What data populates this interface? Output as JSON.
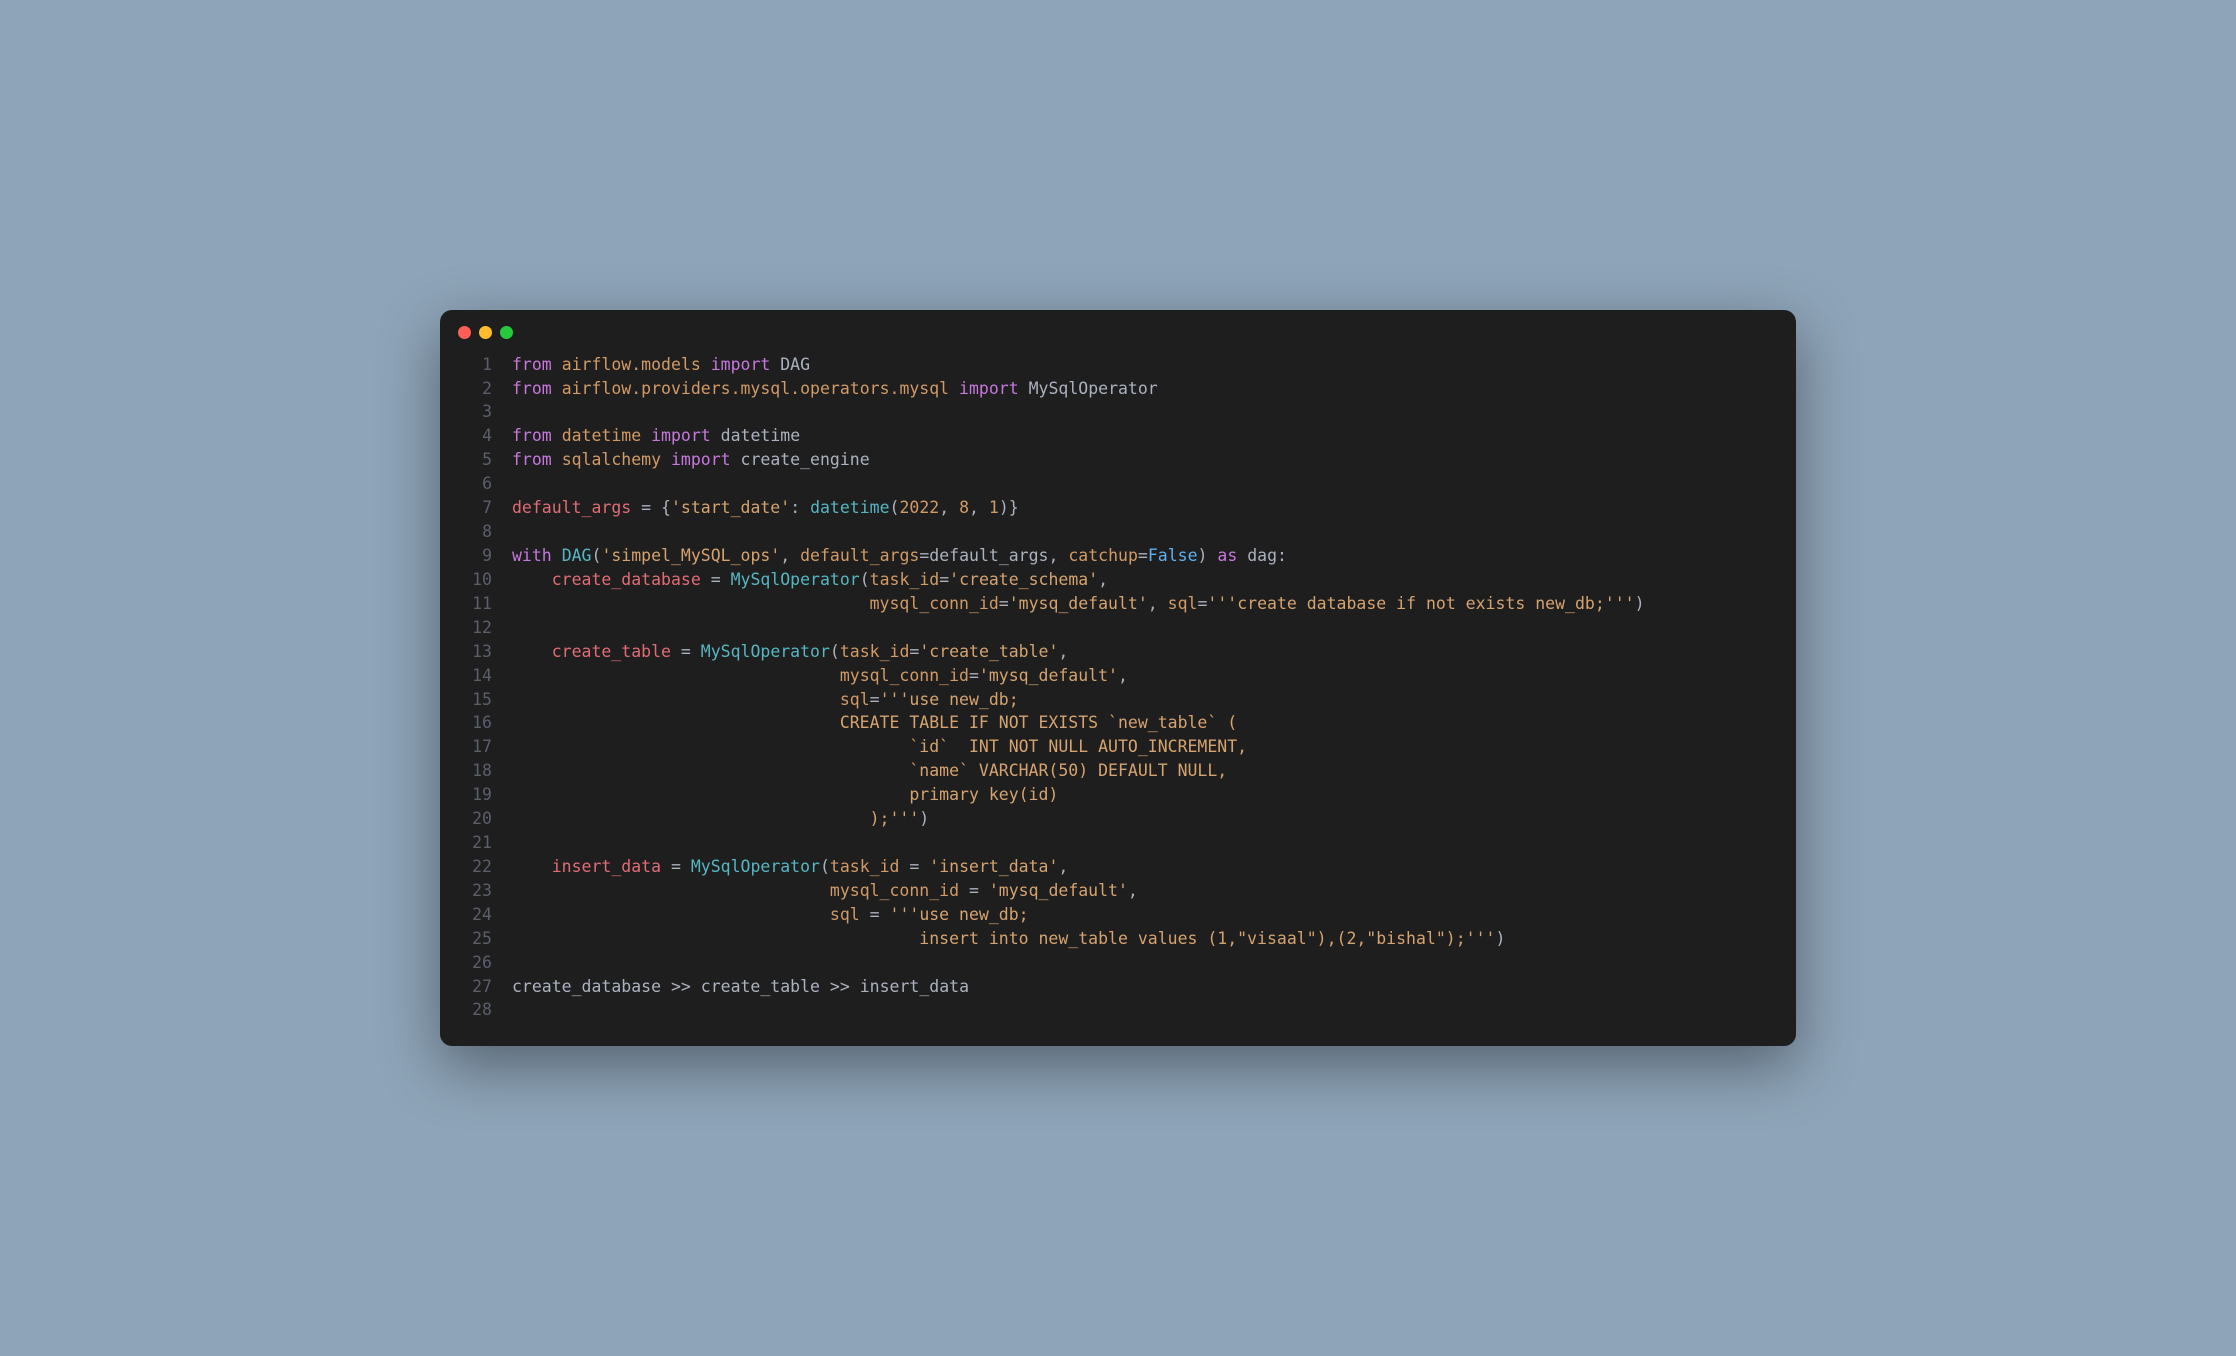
{
  "window": {
    "dots": [
      "red",
      "yellow",
      "green"
    ]
  },
  "code": {
    "lines": [
      {
        "n": 1,
        "tokens": [
          {
            "cls": "tk-keyword",
            "t": "from"
          },
          {
            "cls": "tk-default",
            "t": " "
          },
          {
            "cls": "tk-module",
            "t": "airflow.models"
          },
          {
            "cls": "tk-default",
            "t": " "
          },
          {
            "cls": "tk-keyword",
            "t": "import"
          },
          {
            "cls": "tk-default",
            "t": " "
          },
          {
            "cls": "tk-ident",
            "t": "DAG"
          }
        ]
      },
      {
        "n": 2,
        "tokens": [
          {
            "cls": "tk-keyword",
            "t": "from"
          },
          {
            "cls": "tk-default",
            "t": " "
          },
          {
            "cls": "tk-module",
            "t": "airflow.providers.mysql.operators.mysql"
          },
          {
            "cls": "tk-default",
            "t": " "
          },
          {
            "cls": "tk-keyword",
            "t": "import"
          },
          {
            "cls": "tk-default",
            "t": " "
          },
          {
            "cls": "tk-ident",
            "t": "MySqlOperator"
          }
        ]
      },
      {
        "n": 3,
        "tokens": []
      },
      {
        "n": 4,
        "tokens": [
          {
            "cls": "tk-keyword",
            "t": "from"
          },
          {
            "cls": "tk-default",
            "t": " "
          },
          {
            "cls": "tk-module",
            "t": "datetime"
          },
          {
            "cls": "tk-default",
            "t": " "
          },
          {
            "cls": "tk-keyword",
            "t": "import"
          },
          {
            "cls": "tk-default",
            "t": " "
          },
          {
            "cls": "tk-ident",
            "t": "datetime"
          }
        ]
      },
      {
        "n": 5,
        "tokens": [
          {
            "cls": "tk-keyword",
            "t": "from"
          },
          {
            "cls": "tk-default",
            "t": " "
          },
          {
            "cls": "tk-module",
            "t": "sqlalchemy"
          },
          {
            "cls": "tk-default",
            "t": " "
          },
          {
            "cls": "tk-keyword",
            "t": "import"
          },
          {
            "cls": "tk-default",
            "t": " "
          },
          {
            "cls": "tk-ident",
            "t": "create_engine"
          }
        ]
      },
      {
        "n": 6,
        "tokens": []
      },
      {
        "n": 7,
        "tokens": [
          {
            "cls": "tk-var",
            "t": "default_args"
          },
          {
            "cls": "tk-default",
            "t": " "
          },
          {
            "cls": "tk-op",
            "t": "="
          },
          {
            "cls": "tk-default",
            "t": " "
          },
          {
            "cls": "tk-paren",
            "t": "{"
          },
          {
            "cls": "tk-string",
            "t": "'start_date'"
          },
          {
            "cls": "tk-op",
            "t": ":"
          },
          {
            "cls": "tk-default",
            "t": " "
          },
          {
            "cls": "tk-func",
            "t": "datetime"
          },
          {
            "cls": "tk-paren",
            "t": "("
          },
          {
            "cls": "tk-number",
            "t": "2022"
          },
          {
            "cls": "tk-op",
            "t": ","
          },
          {
            "cls": "tk-default",
            "t": " "
          },
          {
            "cls": "tk-number",
            "t": "8"
          },
          {
            "cls": "tk-op",
            "t": ","
          },
          {
            "cls": "tk-default",
            "t": " "
          },
          {
            "cls": "tk-number",
            "t": "1"
          },
          {
            "cls": "tk-paren",
            "t": ")}"
          }
        ]
      },
      {
        "n": 8,
        "tokens": []
      },
      {
        "n": 9,
        "tokens": [
          {
            "cls": "tk-keyword",
            "t": "with"
          },
          {
            "cls": "tk-default",
            "t": " "
          },
          {
            "cls": "tk-class",
            "t": "DAG"
          },
          {
            "cls": "tk-paren",
            "t": "("
          },
          {
            "cls": "tk-string",
            "t": "'simpel_MySQL_ops'"
          },
          {
            "cls": "tk-op",
            "t": ","
          },
          {
            "cls": "tk-default",
            "t": " "
          },
          {
            "cls": "tk-param",
            "t": "default_args"
          },
          {
            "cls": "tk-op",
            "t": "="
          },
          {
            "cls": "tk-ident",
            "t": "default_args"
          },
          {
            "cls": "tk-op",
            "t": ","
          },
          {
            "cls": "tk-default",
            "t": " "
          },
          {
            "cls": "tk-param",
            "t": "catchup"
          },
          {
            "cls": "tk-op",
            "t": "="
          },
          {
            "cls": "tk-bool",
            "t": "False"
          },
          {
            "cls": "tk-paren",
            "t": ")"
          },
          {
            "cls": "tk-default",
            "t": " "
          },
          {
            "cls": "tk-keyword",
            "t": "as"
          },
          {
            "cls": "tk-default",
            "t": " "
          },
          {
            "cls": "tk-ident",
            "t": "dag"
          },
          {
            "cls": "tk-op",
            "t": ":"
          }
        ]
      },
      {
        "n": 10,
        "tokens": [
          {
            "cls": "tk-default",
            "t": "    "
          },
          {
            "cls": "tk-var",
            "t": "create_database"
          },
          {
            "cls": "tk-default",
            "t": " "
          },
          {
            "cls": "tk-op",
            "t": "="
          },
          {
            "cls": "tk-default",
            "t": " "
          },
          {
            "cls": "tk-class",
            "t": "MySqlOperator"
          },
          {
            "cls": "tk-paren",
            "t": "("
          },
          {
            "cls": "tk-param",
            "t": "task_id"
          },
          {
            "cls": "tk-op",
            "t": "="
          },
          {
            "cls": "tk-string",
            "t": "'create_schema'"
          },
          {
            "cls": "tk-op",
            "t": ","
          }
        ]
      },
      {
        "n": 11,
        "tokens": [
          {
            "cls": "tk-default",
            "t": "                                    "
          },
          {
            "cls": "tk-param",
            "t": "mysql_conn_id"
          },
          {
            "cls": "tk-op",
            "t": "="
          },
          {
            "cls": "tk-string",
            "t": "'mysq_default'"
          },
          {
            "cls": "tk-op",
            "t": ","
          },
          {
            "cls": "tk-default",
            "t": " "
          },
          {
            "cls": "tk-param",
            "t": "sql"
          },
          {
            "cls": "tk-op",
            "t": "="
          },
          {
            "cls": "tk-string",
            "t": "'''create database if not exists new_db;'''"
          },
          {
            "cls": "tk-paren",
            "t": ")"
          }
        ]
      },
      {
        "n": 12,
        "tokens": []
      },
      {
        "n": 13,
        "tokens": [
          {
            "cls": "tk-default",
            "t": "    "
          },
          {
            "cls": "tk-var",
            "t": "create_table"
          },
          {
            "cls": "tk-default",
            "t": " "
          },
          {
            "cls": "tk-op",
            "t": "="
          },
          {
            "cls": "tk-default",
            "t": " "
          },
          {
            "cls": "tk-class",
            "t": "MySqlOperator"
          },
          {
            "cls": "tk-paren",
            "t": "("
          },
          {
            "cls": "tk-param",
            "t": "task_id"
          },
          {
            "cls": "tk-op",
            "t": "="
          },
          {
            "cls": "tk-string",
            "t": "'create_table'"
          },
          {
            "cls": "tk-op",
            "t": ","
          }
        ]
      },
      {
        "n": 14,
        "tokens": [
          {
            "cls": "tk-default",
            "t": "                                 "
          },
          {
            "cls": "tk-param",
            "t": "mysql_conn_id"
          },
          {
            "cls": "tk-op",
            "t": "="
          },
          {
            "cls": "tk-string",
            "t": "'mysq_default'"
          },
          {
            "cls": "tk-op",
            "t": ","
          }
        ]
      },
      {
        "n": 15,
        "tokens": [
          {
            "cls": "tk-default",
            "t": "                                 "
          },
          {
            "cls": "tk-param",
            "t": "sql"
          },
          {
            "cls": "tk-op",
            "t": "="
          },
          {
            "cls": "tk-string",
            "t": "'''use new_db;"
          }
        ]
      },
      {
        "n": 16,
        "tokens": [
          {
            "cls": "tk-string",
            "t": "                                 CREATE TABLE IF NOT EXISTS `new_table` ("
          }
        ]
      },
      {
        "n": 17,
        "tokens": [
          {
            "cls": "tk-string",
            "t": "                                        `id`  INT NOT NULL AUTO_INCREMENT,"
          }
        ]
      },
      {
        "n": 18,
        "tokens": [
          {
            "cls": "tk-string",
            "t": "                                        `name` VARCHAR(50) DEFAULT NULL,"
          }
        ]
      },
      {
        "n": 19,
        "tokens": [
          {
            "cls": "tk-string",
            "t": "                                        primary key(id)"
          }
        ]
      },
      {
        "n": 20,
        "tokens": [
          {
            "cls": "tk-string",
            "t": "                                    );'''"
          },
          {
            "cls": "tk-paren",
            "t": ")"
          }
        ]
      },
      {
        "n": 21,
        "tokens": []
      },
      {
        "n": 22,
        "tokens": [
          {
            "cls": "tk-default",
            "t": "    "
          },
          {
            "cls": "tk-var",
            "t": "insert_data"
          },
          {
            "cls": "tk-default",
            "t": " "
          },
          {
            "cls": "tk-op",
            "t": "="
          },
          {
            "cls": "tk-default",
            "t": " "
          },
          {
            "cls": "tk-class",
            "t": "MySqlOperator"
          },
          {
            "cls": "tk-paren",
            "t": "("
          },
          {
            "cls": "tk-param",
            "t": "task_id"
          },
          {
            "cls": "tk-default",
            "t": " "
          },
          {
            "cls": "tk-op",
            "t": "="
          },
          {
            "cls": "tk-default",
            "t": " "
          },
          {
            "cls": "tk-string",
            "t": "'insert_data'"
          },
          {
            "cls": "tk-op",
            "t": ","
          }
        ]
      },
      {
        "n": 23,
        "tokens": [
          {
            "cls": "tk-default",
            "t": "                                "
          },
          {
            "cls": "tk-param",
            "t": "mysql_conn_id"
          },
          {
            "cls": "tk-default",
            "t": " "
          },
          {
            "cls": "tk-op",
            "t": "="
          },
          {
            "cls": "tk-default",
            "t": " "
          },
          {
            "cls": "tk-string",
            "t": "'mysq_default'"
          },
          {
            "cls": "tk-op",
            "t": ","
          }
        ]
      },
      {
        "n": 24,
        "tokens": [
          {
            "cls": "tk-default",
            "t": "                                "
          },
          {
            "cls": "tk-param",
            "t": "sql"
          },
          {
            "cls": "tk-default",
            "t": " "
          },
          {
            "cls": "tk-op",
            "t": "="
          },
          {
            "cls": "tk-default",
            "t": " "
          },
          {
            "cls": "tk-string",
            "t": "'''use new_db;"
          }
        ]
      },
      {
        "n": 25,
        "tokens": [
          {
            "cls": "tk-string",
            "t": "                                         insert into new_table values (1,\"visaal\"),(2,\"bishal\");'''"
          },
          {
            "cls": "tk-paren",
            "t": ")"
          }
        ]
      },
      {
        "n": 26,
        "tokens": []
      },
      {
        "n": 27,
        "tokens": [
          {
            "cls": "tk-ident",
            "t": "create_database"
          },
          {
            "cls": "tk-default",
            "t": " "
          },
          {
            "cls": "tk-op",
            "t": ">>"
          },
          {
            "cls": "tk-default",
            "t": " "
          },
          {
            "cls": "tk-ident",
            "t": "create_table"
          },
          {
            "cls": "tk-default",
            "t": " "
          },
          {
            "cls": "tk-op",
            "t": ">>"
          },
          {
            "cls": "tk-default",
            "t": " "
          },
          {
            "cls": "tk-ident",
            "t": "insert_data"
          }
        ]
      },
      {
        "n": 28,
        "tokens": []
      }
    ]
  }
}
